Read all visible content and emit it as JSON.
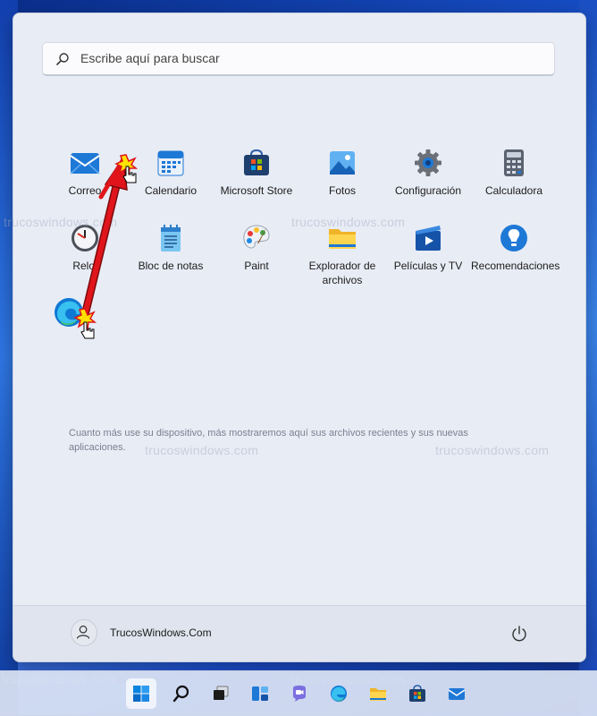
{
  "search": {
    "placeholder": "Escribe aquí para buscar"
  },
  "apps": [
    {
      "label": "Correo",
      "icon": "mail-icon"
    },
    {
      "label": "Calendario",
      "icon": "calendar-icon"
    },
    {
      "label": "Microsoft Store",
      "icon": "store-icon"
    },
    {
      "label": "Fotos",
      "icon": "photos-icon"
    },
    {
      "label": "Configuración",
      "icon": "gear-icon"
    },
    {
      "label": "Calculadora",
      "icon": "calculator-icon"
    },
    {
      "label": "Reloj",
      "icon": "clock-icon"
    },
    {
      "label": "Bloc de notas",
      "icon": "notepad-icon"
    },
    {
      "label": "Paint",
      "icon": "paint-icon"
    },
    {
      "label": "Explorador de archivos",
      "icon": "folder-icon"
    },
    {
      "label": "Películas y TV",
      "icon": "movies-icon"
    },
    {
      "label": "Recomendaciones",
      "icon": "tips-icon"
    }
  ],
  "dragged_app": {
    "icon": "edge-icon"
  },
  "recommended_hint": "Cuanto más use su dispositivo, más mostraremos aquí sus archivos recientes y sus nuevas aplicaciones.",
  "user": {
    "name": "TrucosWindows.Com"
  },
  "watermark": "trucoswindows.com",
  "taskbar": [
    "start-icon",
    "search-icon",
    "task-view-icon",
    "widgets-icon",
    "teams-chat-icon",
    "edge-icon",
    "file-explorer-icon",
    "store-icon",
    "mail-icon"
  ],
  "colors": {
    "accent": "#0067c0",
    "arrow": "#e0151b"
  }
}
